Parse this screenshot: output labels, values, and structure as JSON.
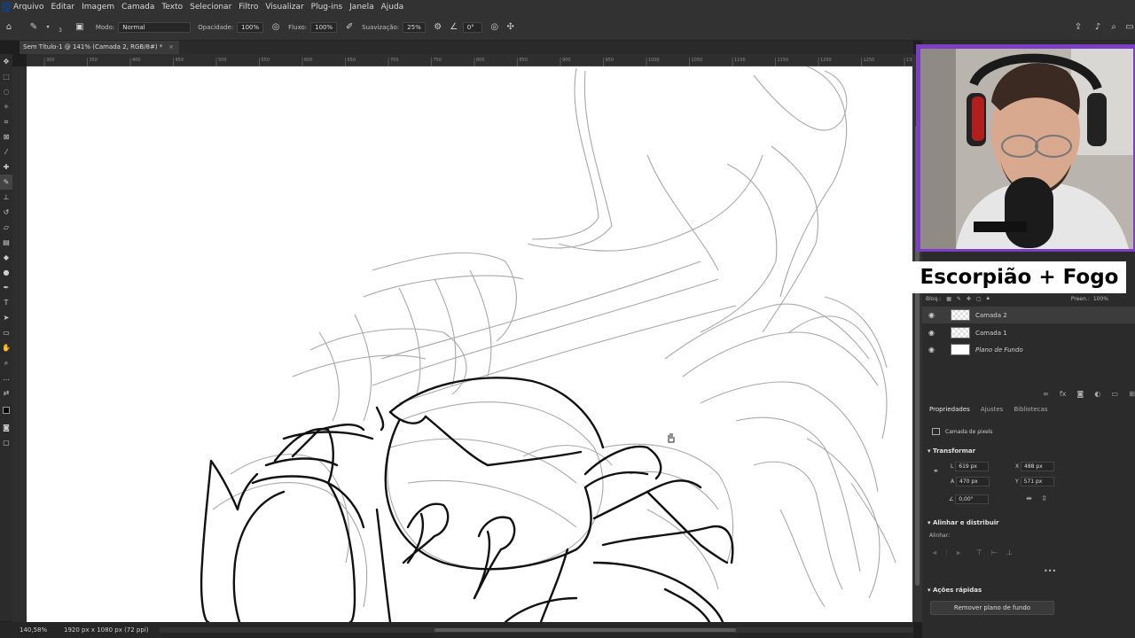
{
  "menu": [
    "Arquivo",
    "Editar",
    "Imagem",
    "Camada",
    "Texto",
    "Selecionar",
    "Filtro",
    "Visualizar",
    "Plug-ins",
    "Janela",
    "Ajuda"
  ],
  "options": {
    "mode_label": "Modo:",
    "mode_value": "Normal",
    "opacity_label": "Opacidade:",
    "opacity_value": "100%",
    "flow_label": "Fluxo:",
    "flow_value": "100%",
    "smoothing_label": "Suavização:",
    "smoothing_value": "25%",
    "angle_value": "0°",
    "brush_size": "3"
  },
  "document_tab": "Sem Título-1 @ 141% (Camada 2, RGB/8#) *",
  "ruler_marks": [
    "300",
    "350",
    "400",
    "450",
    "500",
    "550",
    "600",
    "650",
    "700",
    "750",
    "800",
    "850",
    "900",
    "950",
    "1000",
    "1050",
    "1100",
    "1150",
    "1200",
    "1250",
    "1300"
  ],
  "status": {
    "zoom": "140,58%",
    "doc_size": "1920 px x 1080 px (72 ppi)"
  },
  "overlay_title": "Escorpião + Fogo",
  "layers": {
    "lock_label": "Bloq.:",
    "fill_label": "Preen.:",
    "fill_value": "100%",
    "items": [
      {
        "name": "Camada 2",
        "thumb": "trans",
        "active": true
      },
      {
        "name": "Camada 1",
        "thumb": "trans",
        "active": false
      },
      {
        "name": "Plano de Fundo",
        "thumb": "white",
        "active": false
      }
    ]
  },
  "properties": {
    "tabs": [
      "Propriedades",
      "Ajustes",
      "Bibliotecas"
    ],
    "layer_type": "Camada de pixels",
    "transform_title": "Transformar",
    "L": "619 px",
    "A": "470 px",
    "X": "488 px",
    "Y": "571 px",
    "angle": "0,00°",
    "align_title": "Alinhar e distribuir",
    "align_label": "Alinhar:",
    "quick_title": "Ações rápidas",
    "remove_bg_button": "Remover plano de fundo"
  }
}
